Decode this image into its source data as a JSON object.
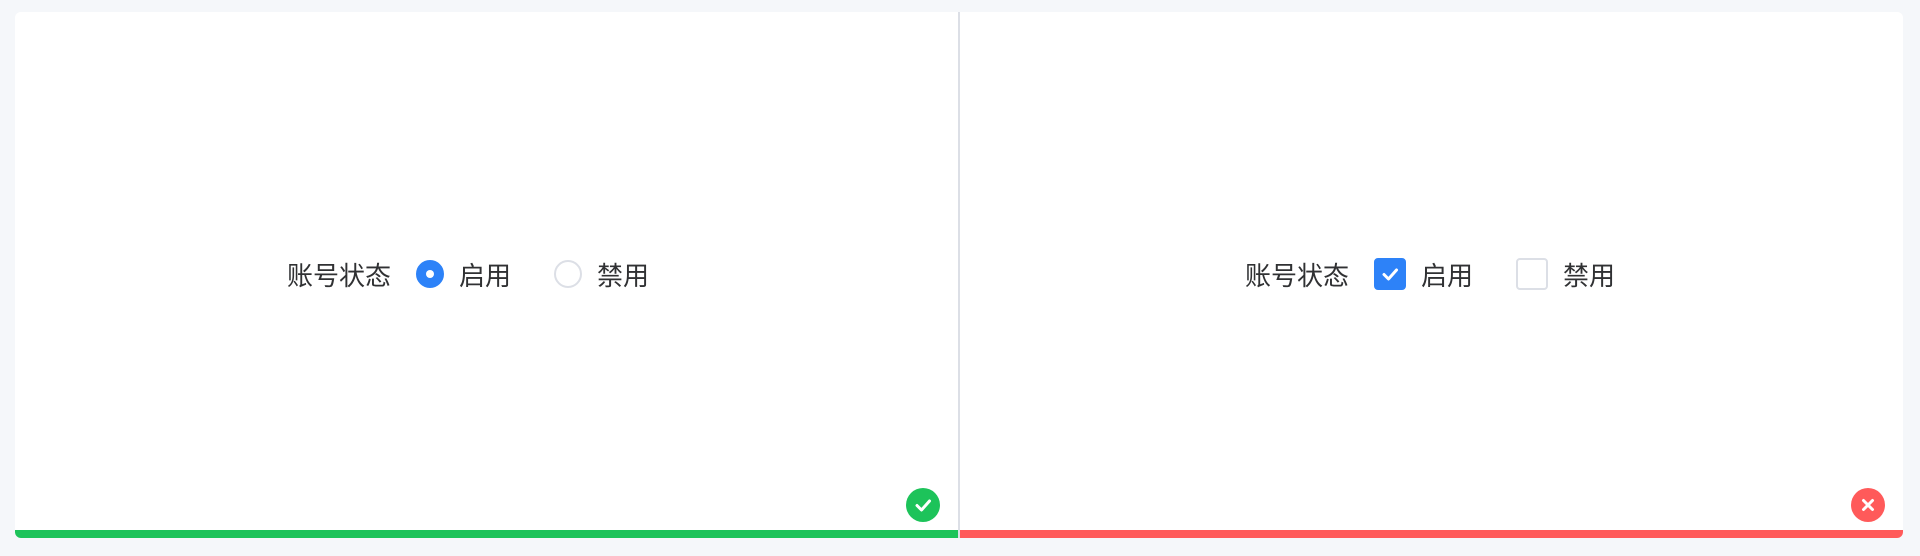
{
  "colors": {
    "accent": "#2d82f8",
    "correct": "#1dc35a",
    "incorrect": "#ff5a5a",
    "border": "#dcdfe6"
  },
  "left_panel": {
    "field_label": "账号状态",
    "options": [
      {
        "label": "启用",
        "checked": true,
        "control": "radio"
      },
      {
        "label": "禁用",
        "checked": false,
        "control": "radio"
      }
    ],
    "status": "correct",
    "status_icon": "check-icon"
  },
  "right_panel": {
    "field_label": "账号状态",
    "options": [
      {
        "label": "启用",
        "checked": true,
        "control": "checkbox"
      },
      {
        "label": "禁用",
        "checked": false,
        "control": "checkbox"
      }
    ],
    "status": "incorrect",
    "status_icon": "close-icon"
  }
}
